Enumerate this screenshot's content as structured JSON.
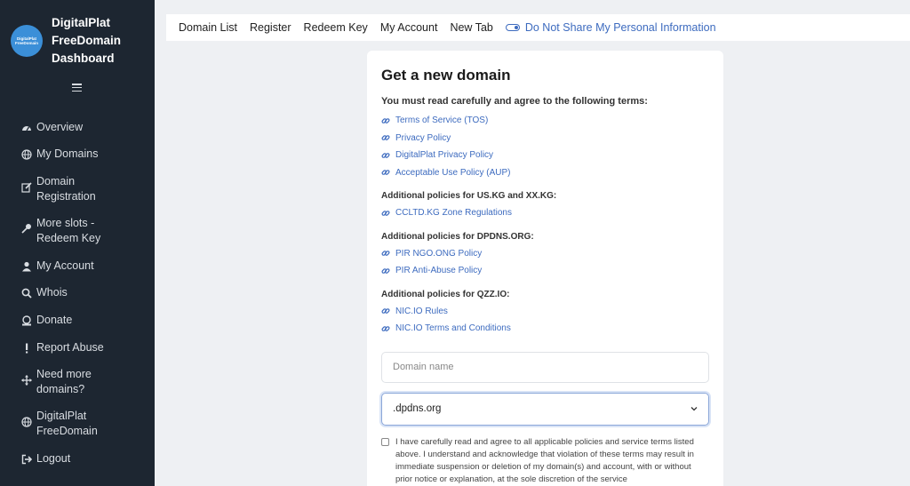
{
  "sidebar": {
    "logo_line1": "DigitalPlat",
    "logo_line2": "FreeDomain",
    "brand_line1": "DigitalPlat",
    "brand_line2": "FreeDomain",
    "brand_line3": "Dashboard",
    "items": [
      {
        "label": "Overview",
        "icon": "dashboard-icon"
      },
      {
        "label": "My Domains",
        "icon": "globe-icon"
      },
      {
        "label": "Domain Registration",
        "icon": "edit-icon"
      },
      {
        "label": "More slots - Redeem Key",
        "icon": "key-icon"
      },
      {
        "label": "My Account",
        "icon": "user-icon"
      },
      {
        "label": "Whois",
        "icon": "search-icon"
      },
      {
        "label": "Donate",
        "icon": "donate-icon"
      },
      {
        "label": "Report Abuse",
        "icon": "exclamation-icon"
      },
      {
        "label": "Need more domains?",
        "icon": "arrows-icon"
      },
      {
        "label": "DigitalPlat FreeDomain",
        "icon": "globe-icon"
      },
      {
        "label": "Logout",
        "icon": "logout-icon"
      }
    ]
  },
  "topbar": {
    "links": [
      "Domain List",
      "Register",
      "Redeem Key",
      "My Account",
      "New Tab"
    ],
    "privacy": "Do Not Share My Personal Information"
  },
  "card": {
    "title": "Get a new domain",
    "intro": "You must read carefully and agree to the following terms:",
    "links": [
      "Terms of Service (TOS)",
      "Privacy Policy",
      "DigitalPlat Privacy Policy",
      "Acceptable Use Policy (AUP)"
    ],
    "sections": [
      {
        "title": "Additional policies for US.KG and XX.KG:",
        "links": [
          "CCLTD.KG Zone Regulations"
        ]
      },
      {
        "title": "Additional policies for DPDNS.ORG:",
        "links": [
          "PIR NGO.ONG Policy",
          "PIR Anti-Abuse Policy"
        ]
      },
      {
        "title": "Additional policies for QZZ.IO:",
        "links": [
          "NIC.IO Rules",
          "NIC.IO Terms and Conditions"
        ]
      }
    ],
    "domain_placeholder": "Domain name",
    "tld_selected": ".dpdns.org",
    "agree_text": "I have carefully read and agree to all applicable policies and service terms listed above. I understand and acknowledge that violation of these terms may result in immediate suspension or deletion of my domain(s) and account, with or without prior notice or explanation, at the sole discretion of the service"
  },
  "colors": {
    "sidebar_bg": "#1d2631",
    "link": "#3d6bbf",
    "page_bg": "#eef0f3"
  }
}
